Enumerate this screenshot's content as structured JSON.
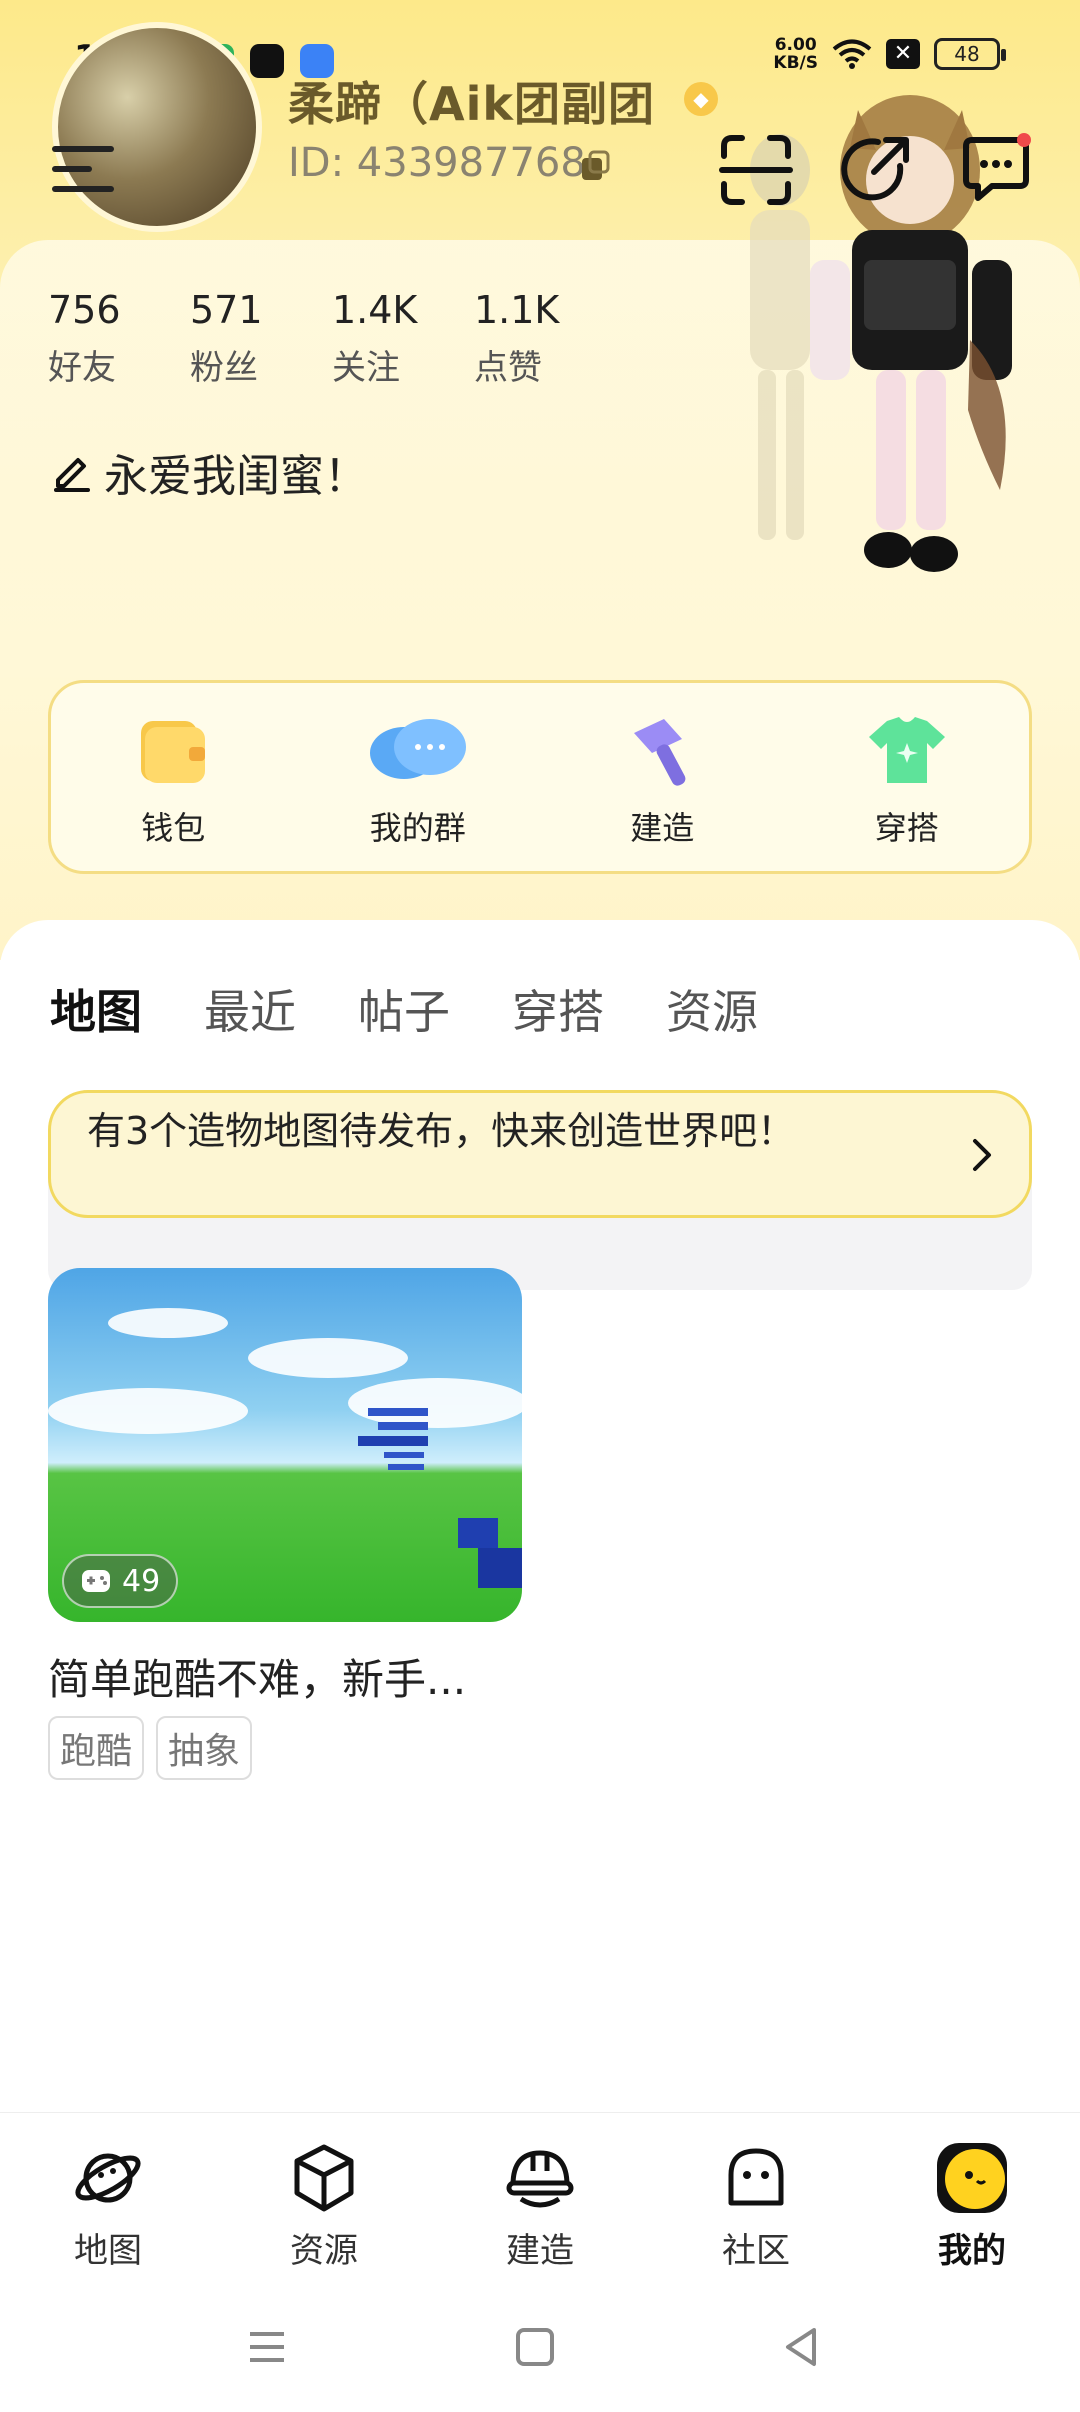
{
  "status_bar": {
    "time": "19:55",
    "net_speed_value": "6.00",
    "net_speed_unit": "KB/S",
    "battery": "48"
  },
  "profile": {
    "name": "柔蹄（Aik团副团",
    "id_label": "ID: 433987768"
  },
  "stats": [
    {
      "value": "756",
      "label": "好友"
    },
    {
      "value": "571",
      "label": "粉丝"
    },
    {
      "value": "1.4K",
      "label": "关注"
    },
    {
      "value": "1.1K",
      "label": "点赞"
    }
  ],
  "bio": "永爱我闺蜜！",
  "shortcuts": [
    {
      "label": "钱包",
      "icon": "wallet-icon"
    },
    {
      "label": "我的群",
      "icon": "chat-group-icon"
    },
    {
      "label": "建造",
      "icon": "hammer-icon"
    },
    {
      "label": "穿搭",
      "icon": "outfit-icon"
    }
  ],
  "tabs": [
    "地图",
    "最近",
    "帖子",
    "穿搭",
    "资源"
  ],
  "active_tab": "地图",
  "notice": {
    "text": "有3个造物地图待发布，快来创造世界吧！"
  },
  "map_card": {
    "play_count": "49",
    "title": "简单跑酷不难，新手...",
    "tags": [
      "跑酷",
      "抽象"
    ]
  },
  "bottom_nav": [
    {
      "label": "地图",
      "icon": "planet-icon"
    },
    {
      "label": "资源",
      "icon": "cube-icon"
    },
    {
      "label": "建造",
      "icon": "helmet-icon"
    },
    {
      "label": "社区",
      "icon": "ghost-icon"
    },
    {
      "label": "我的",
      "icon": "chick-icon"
    }
  ],
  "colors": {
    "accent_yellow": "#ffe14a",
    "notice_border": "#f2d960",
    "header_bg": "#fde98a"
  }
}
